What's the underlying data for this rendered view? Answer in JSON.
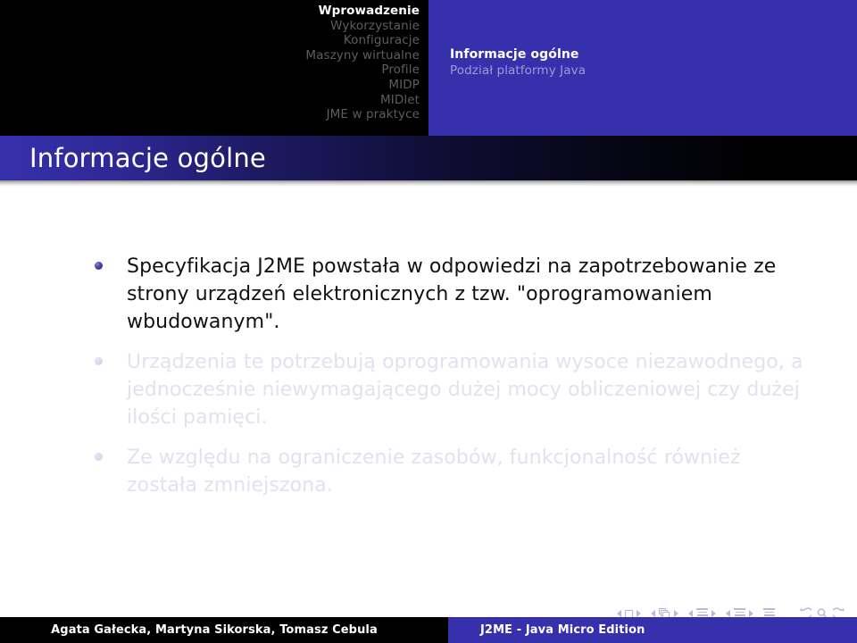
{
  "header": {
    "nav_items": [
      {
        "label": "Wprowadzenie",
        "current": true
      },
      {
        "label": "Wykorzystanie",
        "current": false
      },
      {
        "label": "Konfiguracje",
        "current": false
      },
      {
        "label": "Maszyny wirtualne",
        "current": false
      },
      {
        "label": "Profile",
        "current": false
      },
      {
        "label": "MIDP",
        "current": false
      },
      {
        "label": "MIDlet",
        "current": false
      },
      {
        "label": "JME w praktyce",
        "current": false
      }
    ],
    "subsection_title": "Informacje ogólne",
    "subsection_subtitle": "Podział platformy Java"
  },
  "title_bar": {
    "title": "Informacje ogólne"
  },
  "content": {
    "bullets": [
      {
        "text": "Specyfikacja J2ME powstała w odpowiedzi na zapotrzebowanie ze strony urządzeń elektronicznych z tzw. \"oprogramowaniem wbudowanym\".",
        "dimmed": false
      },
      {
        "text": "Urządzenia te potrzebują oprogramowania wysoce niezawodnego, a jednocześnie niewymagającego dużej mocy obliczeniowej czy dużej ilości pamięci.",
        "dimmed": true
      },
      {
        "text": "Ze względu na ograniczenie zasobów, funkcjonalność również została zmniejszona.",
        "dimmed": true
      }
    ]
  },
  "nav_symbols": [
    {
      "name": "slide-navigation",
      "icon": "square"
    },
    {
      "name": "frame-navigation",
      "icon": "stacked-squares"
    },
    {
      "name": "subsection-navigation",
      "icon": "lines"
    },
    {
      "name": "section-navigation",
      "icon": "lines"
    },
    {
      "name": "document-navigation",
      "icon": "lines"
    },
    {
      "name": "back-navigation",
      "icon": "back-arrow"
    },
    {
      "name": "search-navigation",
      "icon": "magnifier"
    },
    {
      "name": "forward-navigation",
      "icon": "forward-arrow"
    }
  ],
  "footer": {
    "authors": "Agata Gałecka, Martyna Sikorska, Tomasz Cebula",
    "presentation_title": "J2ME - Java Micro Edition"
  },
  "colors": {
    "brand_blue": "#3730ad",
    "header_black": "#000000",
    "bullet_dot": "#4b44a8",
    "dim_text": "#e2e1ef",
    "nav_dim": "#5d5d63"
  }
}
